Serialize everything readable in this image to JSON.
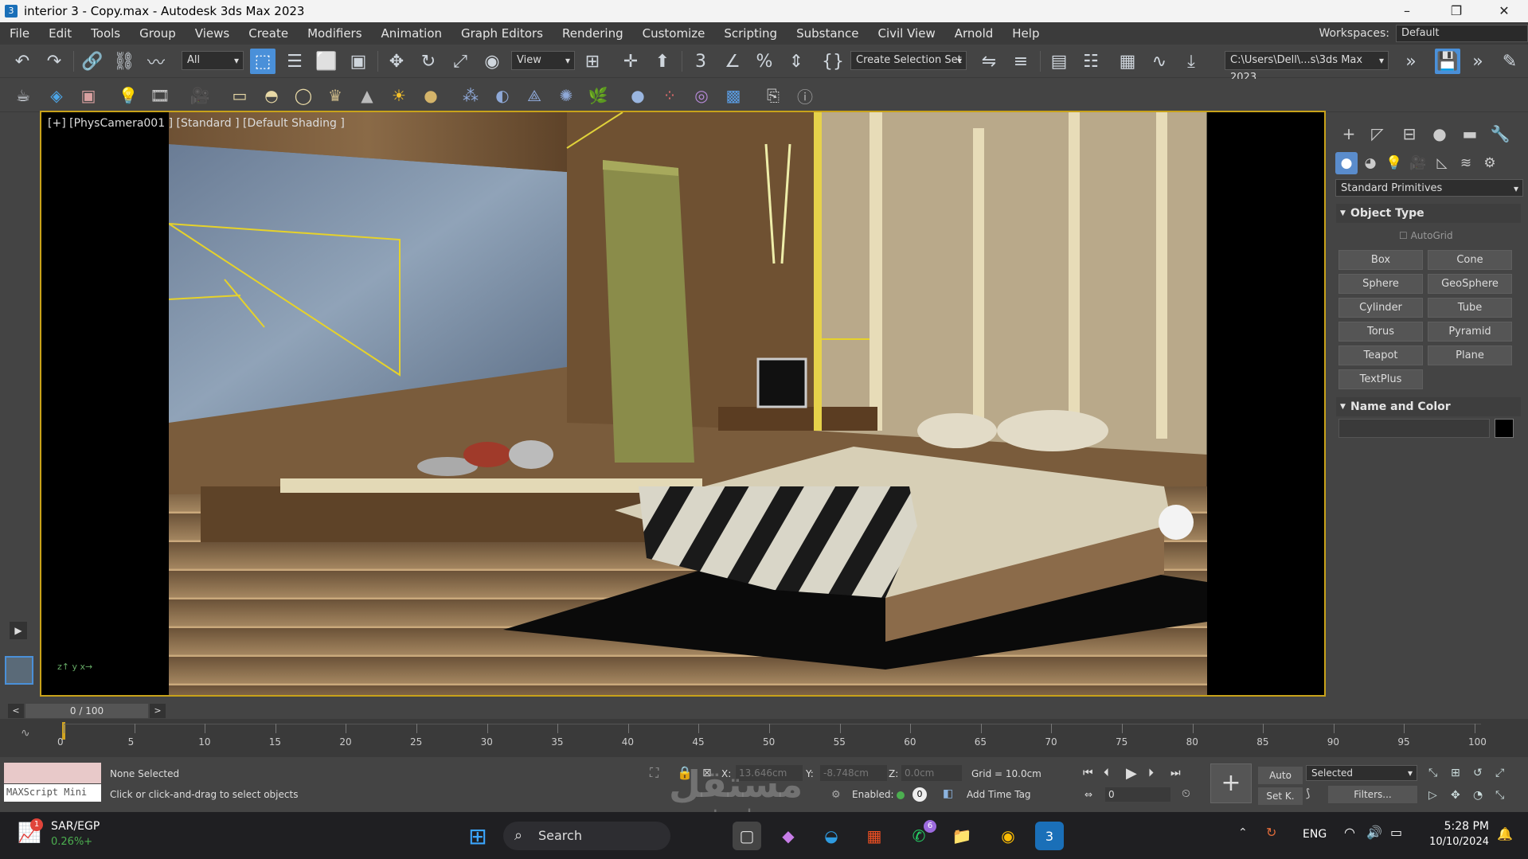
{
  "window": {
    "title": "interior 3 - Copy.max - Autodesk 3ds Max 2023",
    "app_icon": "3"
  },
  "menu": [
    "File",
    "Edit",
    "Tools",
    "Group",
    "Views",
    "Create",
    "Modifiers",
    "Animation",
    "Graph Editors",
    "Rendering",
    "Customize",
    "Scripting",
    "Substance",
    "Civil View",
    "Arnold",
    "Help"
  ],
  "workspace": {
    "label": "Workspaces:",
    "value": "Default"
  },
  "toolbar": {
    "filter_value": "All",
    "ref_coord": "View",
    "selection_set": "Create Selection Set",
    "path": "C:\\Users\\Dell\\...s\\3ds Max 2023"
  },
  "viewport": {
    "label": "[+] [PhysCamera001 ] [Standard ] [Default Shading ]"
  },
  "command_panel": {
    "category": "Standard Primitives",
    "object_type_title": "Object Type",
    "autogrid": "AutoGrid",
    "buttons": [
      "Box",
      "Cone",
      "Sphere",
      "GeoSphere",
      "Cylinder",
      "Tube",
      "Torus",
      "Pyramid",
      "Teapot",
      "Plane",
      "TextPlus"
    ],
    "name_color_title": "Name and Color",
    "color_swatch": "#000000"
  },
  "timeline": {
    "frame": "0 / 100",
    "ticks": [
      "0",
      "5",
      "10",
      "15",
      "20",
      "25",
      "30",
      "35",
      "40",
      "45",
      "50",
      "55",
      "60",
      "65",
      "70",
      "75",
      "80",
      "85",
      "90",
      "95",
      "100"
    ]
  },
  "status": {
    "maxscript": "MAXScript Mini",
    "selection": "None Selected",
    "prompt": "Click or click-and-drag to select objects",
    "x_label": "X:",
    "x_value": "13.646cm",
    "y_label": "Y:",
    "y_value": "-8.748cm",
    "z_label": "Z:",
    "z_value": "0.0cm",
    "grid": "Grid = 10.0cm",
    "enabled": "Enabled:",
    "time_tag": "Add Time Tag",
    "auto": "Auto",
    "setk": "Set K.",
    "key_filter": "Selected",
    "filters": "Filters...",
    "frame_field": "0"
  },
  "taskbar": {
    "currency": "SAR/EGP",
    "rate": "0.26%+",
    "currency_badge": "1",
    "search": "Search",
    "whatsapp_badge": "6",
    "lang": "ENG",
    "time": "5:28 PM",
    "date": "10/10/2024"
  },
  "watermark": {
    "text_ar": "مستقل",
    "text_en": "mostaql.com"
  }
}
